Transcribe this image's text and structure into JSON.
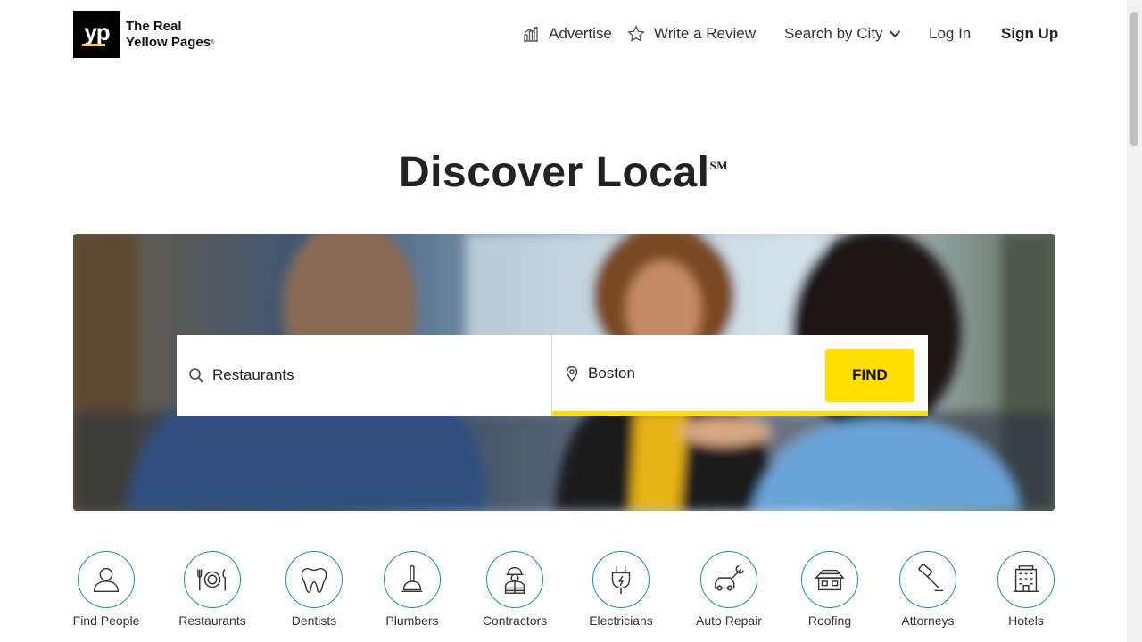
{
  "header": {
    "logo_mark": "yp",
    "logo_text_line1": "The Real",
    "logo_text_line2": "Yellow Pages",
    "logo_reg": "®",
    "nav": {
      "advertise": "Advertise",
      "write_review": "Write a Review",
      "search_by_city": "Search by City",
      "log_in": "Log In",
      "sign_up": "Sign Up"
    }
  },
  "hero": {
    "headline": "Discover Local",
    "headline_mark": "SM",
    "search": {
      "what_value": "Restaurants",
      "where_value": "Boston",
      "find_label": "FIND"
    }
  },
  "categories": [
    {
      "label": "Find People",
      "icon": "person-icon"
    },
    {
      "label": "Restaurants",
      "icon": "plate-utensils-icon"
    },
    {
      "label": "Dentists",
      "icon": "tooth-icon"
    },
    {
      "label": "Plumbers",
      "icon": "plunger-icon"
    },
    {
      "label": "Contractors",
      "icon": "worker-icon"
    },
    {
      "label": "Electricians",
      "icon": "plug-icon"
    },
    {
      "label": "Auto Repair",
      "icon": "car-wrench-icon"
    },
    {
      "label": "Roofing",
      "icon": "house-icon"
    },
    {
      "label": "Attorneys",
      "icon": "gavel-icon"
    },
    {
      "label": "Hotels",
      "icon": "hotel-building-icon"
    }
  ],
  "colors": {
    "brand_yellow": "#ffde00",
    "brand_black": "#000000",
    "icon_teal": "#1f8fa6"
  }
}
